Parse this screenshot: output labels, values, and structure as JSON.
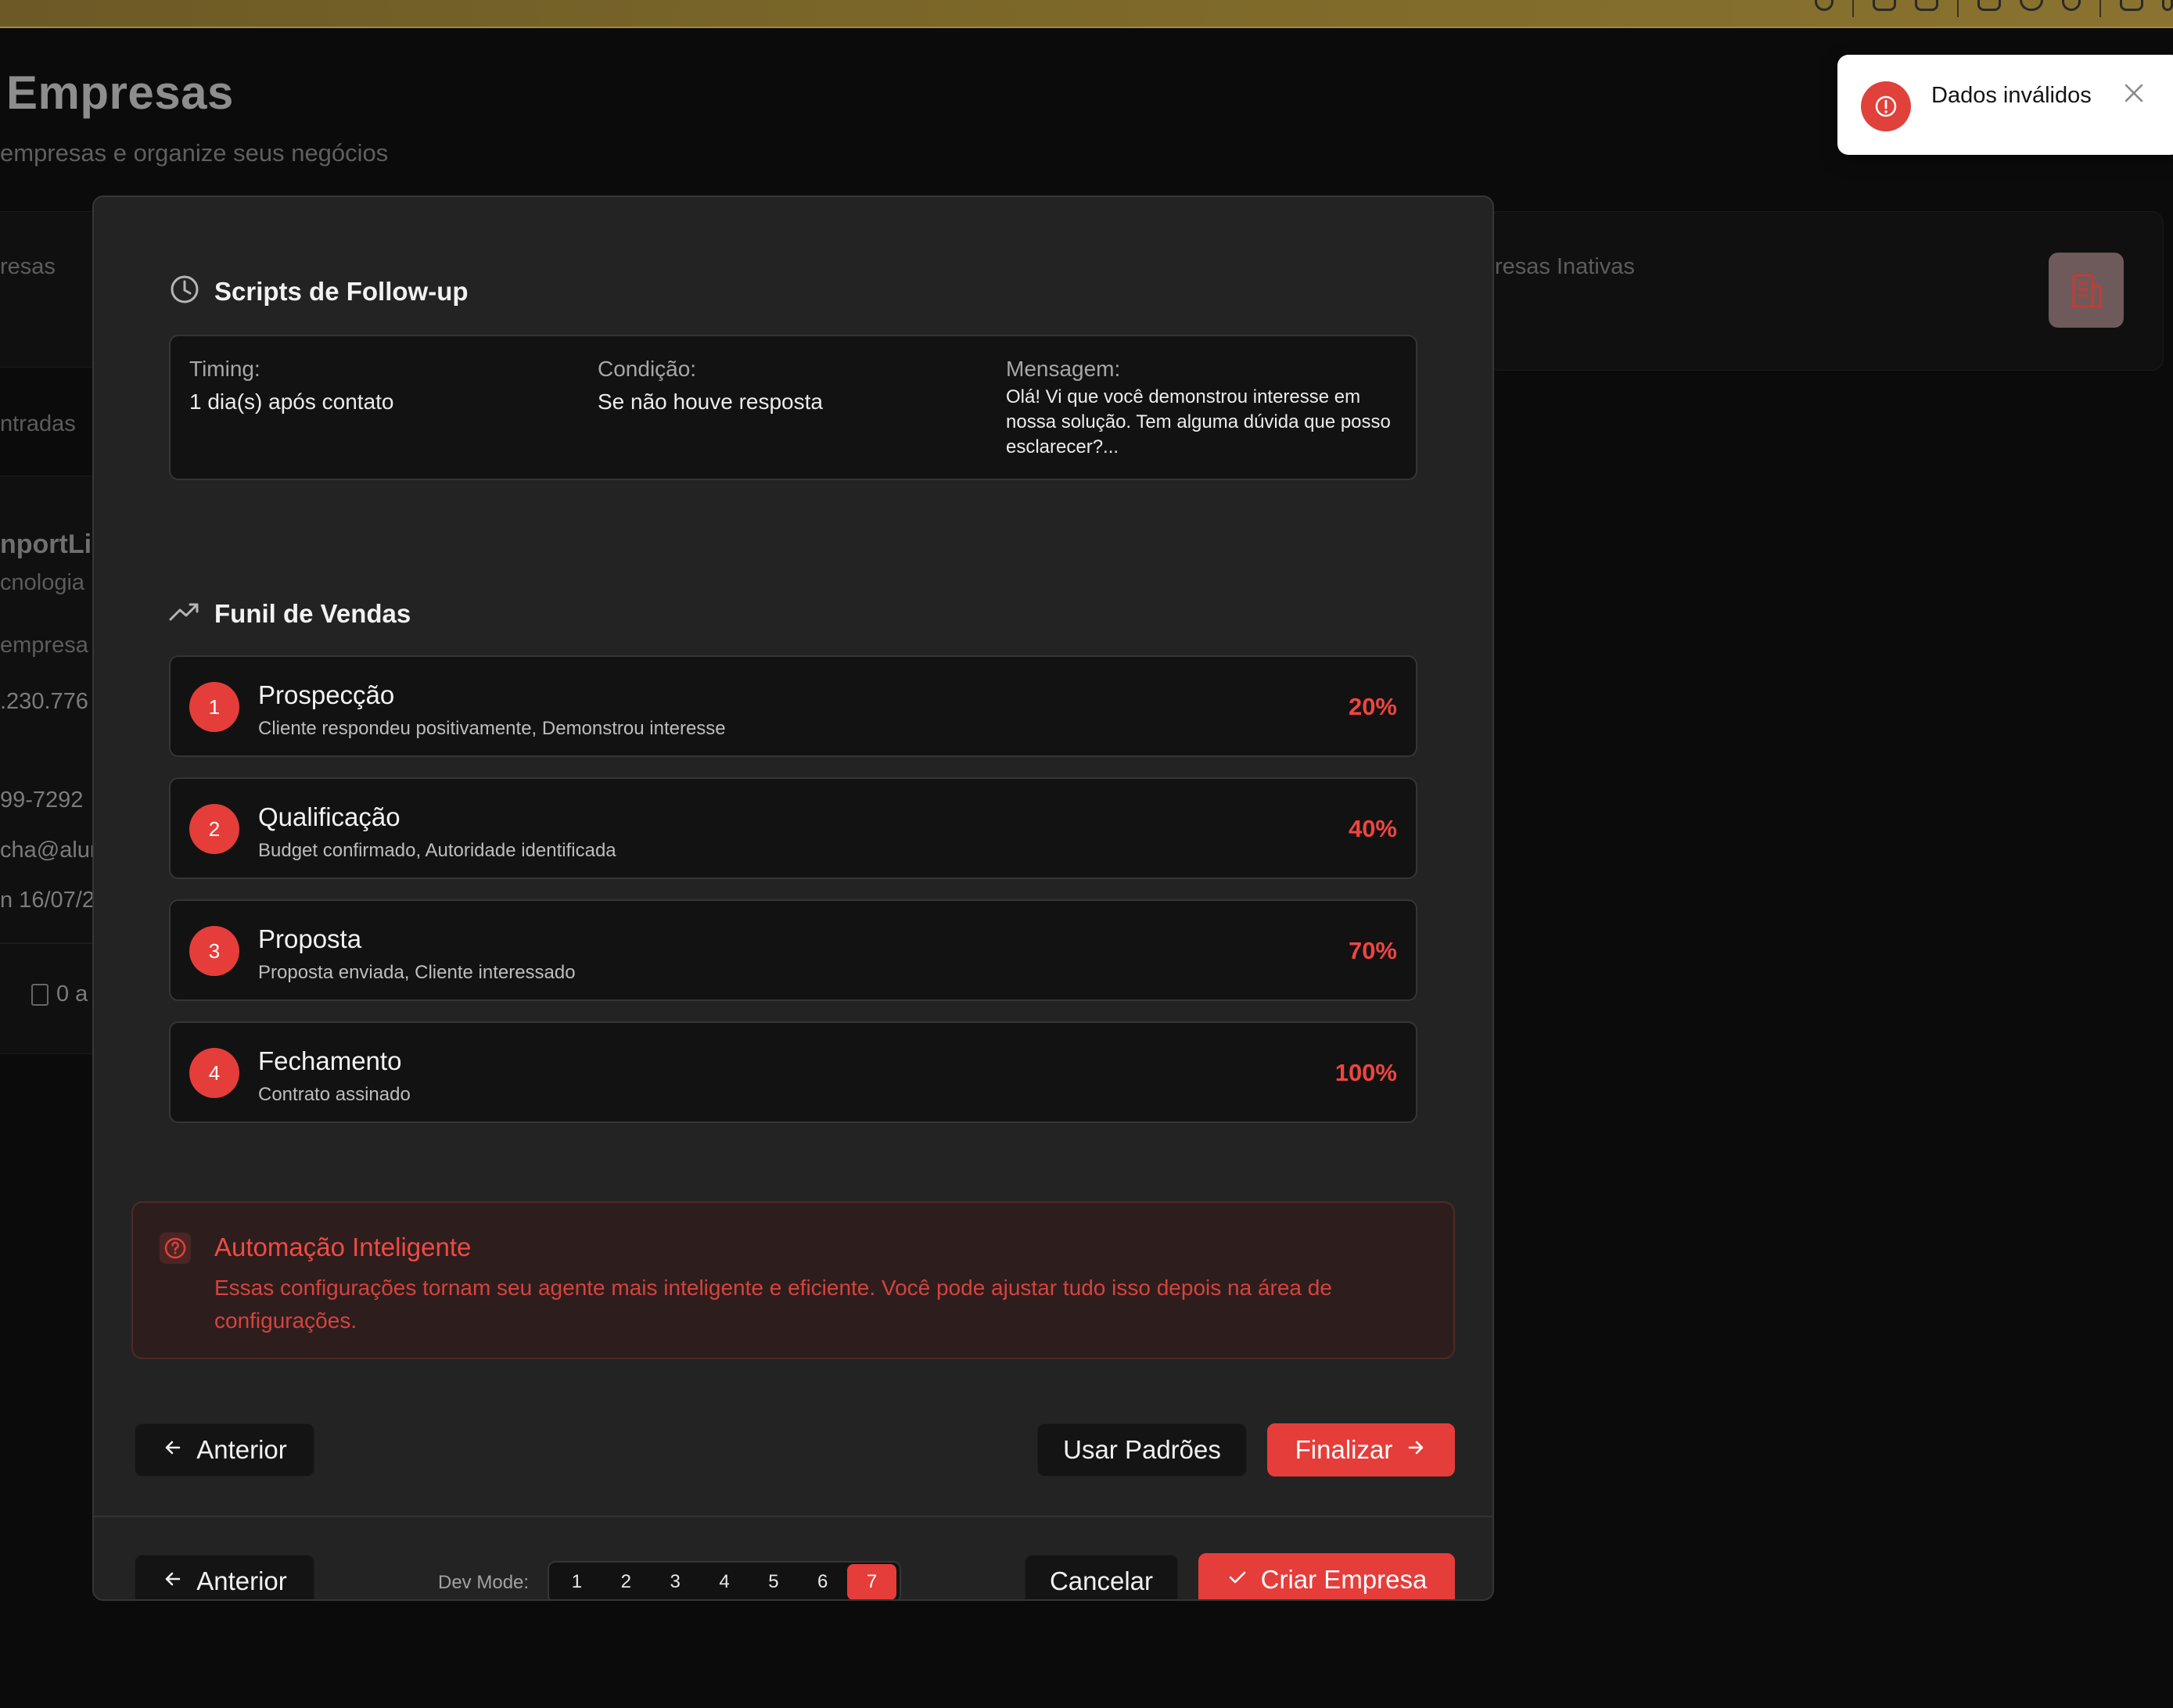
{
  "background": {
    "title": "Empresas",
    "subtitle": "empresas e organize seus negócios",
    "card_left_label": "resas",
    "card_right_label": "resas Inativas",
    "left_labels": [
      "ntradas",
      "nportLi",
      "cnologia",
      "empresa",
      ".230.776",
      "99-7292",
      "cha@alun",
      "n 16/07/2",
      "0 a"
    ]
  },
  "followup": {
    "title": "Scripts de Follow-up",
    "timing_label": "Timing:",
    "timing_value": "1 dia(s) após contato",
    "condition_label": "Condição:",
    "condition_value": "Se não houve resposta",
    "message_label": "Mensagem:",
    "message_value": "Olá! Vi que você demonstrou interesse em nossa solução. Tem alguma dúvida que posso esclarecer?..."
  },
  "funnel": {
    "title": "Funil de Vendas",
    "stages": [
      {
        "num": "1",
        "name": "Prospecção",
        "desc": "Cliente respondeu positivamente, Demonstrou interesse",
        "pct": "20%"
      },
      {
        "num": "2",
        "name": "Qualificação",
        "desc": "Budget confirmado, Autoridade identificada",
        "pct": "40%"
      },
      {
        "num": "3",
        "name": "Proposta",
        "desc": "Proposta enviada, Cliente interessado",
        "pct": "70%"
      },
      {
        "num": "4",
        "name": "Fechamento",
        "desc": "Contrato assinado",
        "pct": "100%"
      }
    ]
  },
  "tip": {
    "title": "Automação Inteligente",
    "text": "Essas configurações tornam seu agente mais inteligente e eficiente. Você pode ajustar tudo isso depois na área de configurações."
  },
  "step_nav": {
    "prev": "Anterior",
    "defaults": "Usar Padrões",
    "finish": "Finalizar"
  },
  "footer": {
    "prev": "Anterior",
    "dev_label": "Dev Mode:",
    "pages": [
      "1",
      "2",
      "3",
      "4",
      "5",
      "6",
      "7"
    ],
    "active_page": "7",
    "cancel": "Cancelar",
    "create": "Criar Empresa"
  },
  "toast": {
    "message": "Dados inválidos"
  },
  "colors": {
    "accent": "#e53d3a",
    "modal_bg": "#232323",
    "card_bg": "#121212"
  }
}
